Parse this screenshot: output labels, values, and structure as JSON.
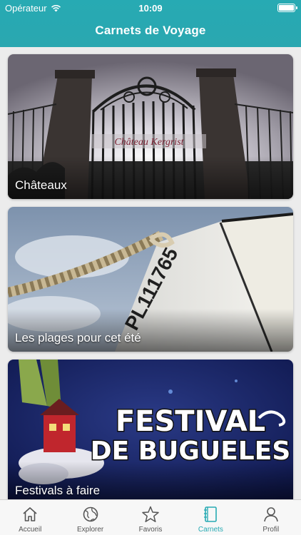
{
  "status": {
    "carrier": "Opérateur",
    "time": "10:09"
  },
  "header": {
    "title": "Carnets de Voyage"
  },
  "cards": [
    {
      "label": "Châteaux",
      "sign": "Château Kergrist"
    },
    {
      "label": "Les plages pour cet été",
      "hull": "PL111765"
    },
    {
      "label": "Festivals à faire",
      "poster_line1": "FESTIVAL",
      "poster_line2": "DE BUGUELES"
    }
  ],
  "tabs": [
    {
      "label": "Accueil",
      "icon": "home-icon"
    },
    {
      "label": "Explorer",
      "icon": "globe-icon"
    },
    {
      "label": "Favoris",
      "icon": "star-icon"
    },
    {
      "label": "Carnets",
      "icon": "notebook-icon",
      "active": true
    },
    {
      "label": "Profil",
      "icon": "user-icon"
    }
  ],
  "colors": {
    "accent": "#27aab3",
    "tab_inactive": "#555555"
  }
}
